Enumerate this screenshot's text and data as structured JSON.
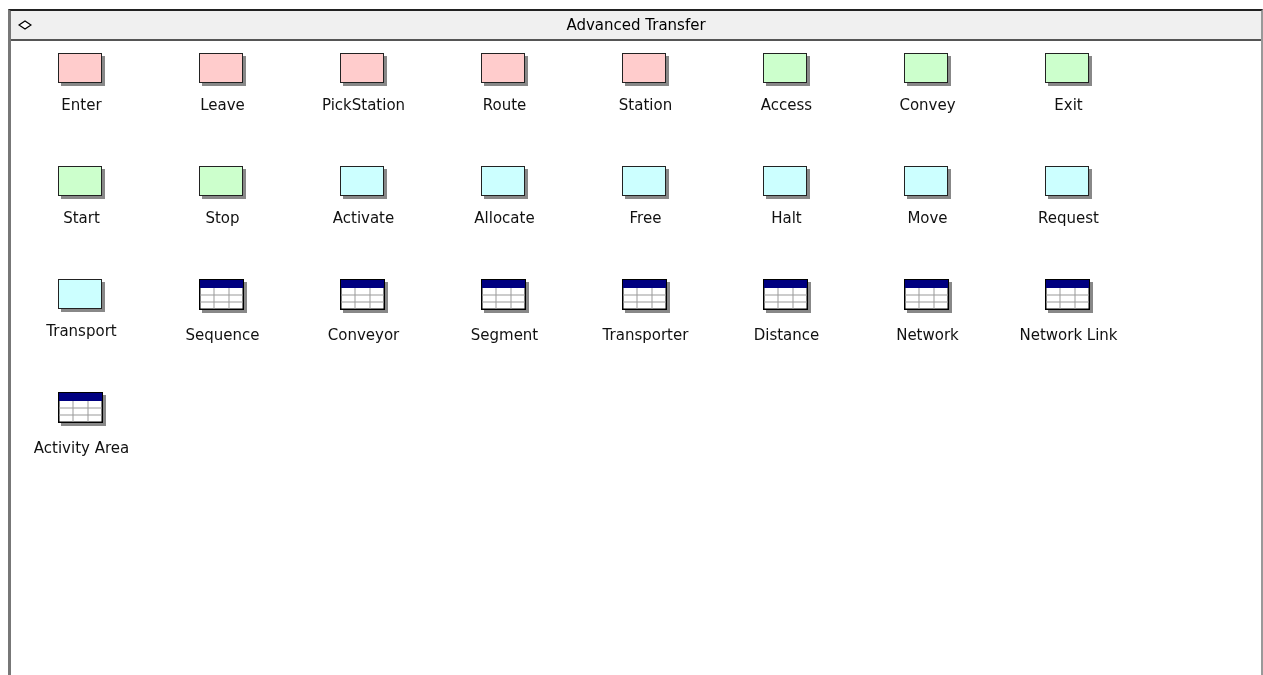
{
  "window": {
    "title": "Advanced Transfer"
  },
  "modules": [
    {
      "label": "Enter",
      "kind": "module",
      "color": "#ffcccc"
    },
    {
      "label": "Leave",
      "kind": "module",
      "color": "#ffcccc"
    },
    {
      "label": "PickStation",
      "kind": "module",
      "color": "#ffcccc"
    },
    {
      "label": "Route",
      "kind": "module",
      "color": "#ffcccc"
    },
    {
      "label": "Station",
      "kind": "module",
      "color": "#ffcccc"
    },
    {
      "label": "Access",
      "kind": "module",
      "color": "#ccffcc"
    },
    {
      "label": "Convey",
      "kind": "module",
      "color": "#ccffcc"
    },
    {
      "label": "Exit",
      "kind": "module",
      "color": "#ccffcc"
    },
    {
      "label": "Start",
      "kind": "module",
      "color": "#ccffcc"
    },
    {
      "label": "Stop",
      "kind": "module",
      "color": "#ccffcc"
    },
    {
      "label": "Activate",
      "kind": "module",
      "color": "#ccffff"
    },
    {
      "label": "Allocate",
      "kind": "module",
      "color": "#ccffff"
    },
    {
      "label": "Free",
      "kind": "module",
      "color": "#ccffff"
    },
    {
      "label": "Halt",
      "kind": "module",
      "color": "#ccffff"
    },
    {
      "label": "Move",
      "kind": "module",
      "color": "#ccffff"
    },
    {
      "label": "Request",
      "kind": "module",
      "color": "#ccffff"
    },
    {
      "label": "Transport",
      "kind": "module",
      "color": "#ccffff"
    },
    {
      "label": "Sequence",
      "kind": "table"
    },
    {
      "label": "Conveyor",
      "kind": "table"
    },
    {
      "label": "Segment",
      "kind": "table"
    },
    {
      "label": "Transporter",
      "kind": "table"
    },
    {
      "label": "Distance",
      "kind": "table"
    },
    {
      "label": "Network",
      "kind": "table"
    },
    {
      "label": "Network Link",
      "kind": "table"
    },
    {
      "label": "Activity Area",
      "kind": "table"
    }
  ]
}
